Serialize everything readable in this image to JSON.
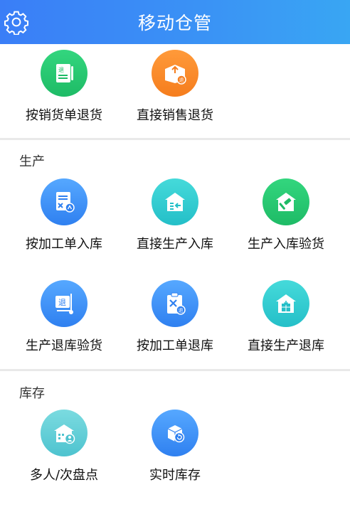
{
  "header": {
    "title": "移动仓管",
    "settings_icon": "gear-icon"
  },
  "top_items": [
    {
      "label": "按销货单退货",
      "icon": "return-document-icon",
      "color": "#1ebb66"
    },
    {
      "label": "直接销售退货",
      "icon": "return-box-icon",
      "color": "#f57d1d"
    }
  ],
  "sections": [
    {
      "title": "生产",
      "items": [
        {
          "label": "按加工单入库",
          "icon": "work-order-icon",
          "color": "#2f80f0"
        },
        {
          "label": "直接生产入库",
          "icon": "warehouse-in-icon",
          "color": "#24bfc8"
        },
        {
          "label": "生产入库验货",
          "icon": "inspection-hammer-icon",
          "color": "#1ebb66"
        },
        {
          "label": "生产退库验货",
          "icon": "return-cart-icon",
          "color": "#2f80f0"
        },
        {
          "label": "按加工单退库",
          "icon": "clipboard-tools-icon",
          "color": "#2f80f0"
        },
        {
          "label": "直接生产退库",
          "icon": "warehouse-return-icon",
          "color": "#24bfc8"
        }
      ]
    },
    {
      "title": "库存",
      "items": [
        {
          "label": "多人/次盘点",
          "icon": "multi-user-stocktake-icon",
          "color": "#4ec3cf"
        },
        {
          "label": "实时库存",
          "icon": "realtime-stock-icon",
          "color": "#2f80f0"
        }
      ]
    }
  ]
}
